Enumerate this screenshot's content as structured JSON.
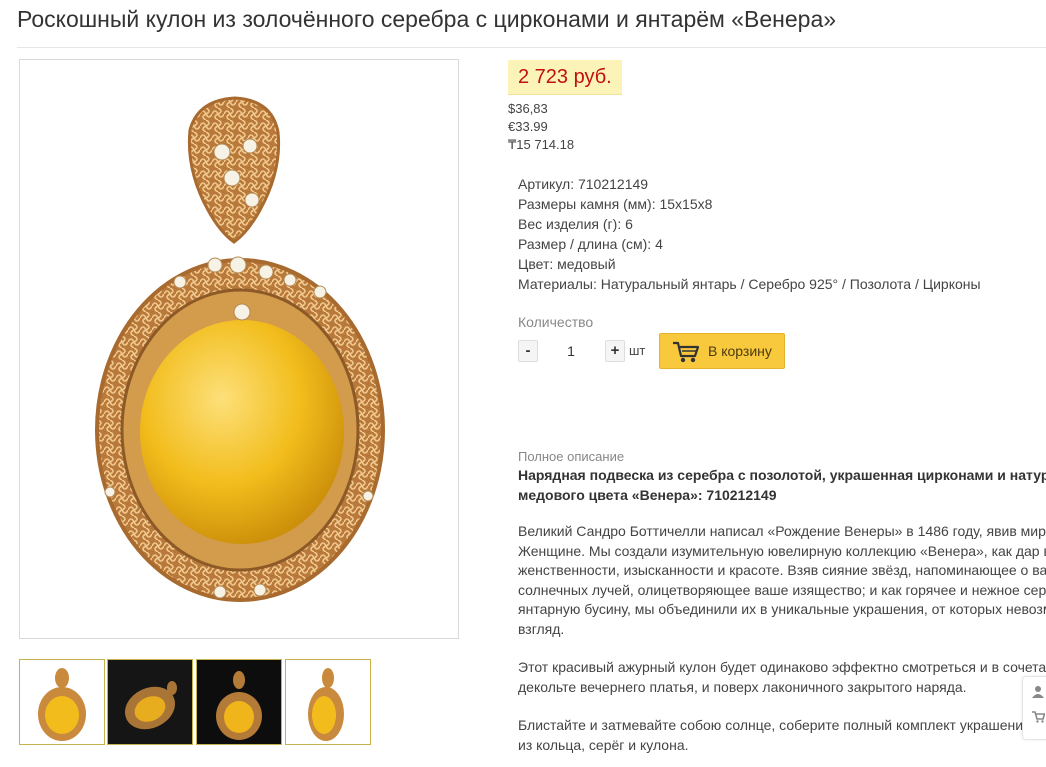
{
  "product": {
    "title": "Роскошный кулон из золочённого серебра с цирконами и янтарём «Венера»"
  },
  "price": {
    "main": "2 723 руб.",
    "usd": "$36,83",
    "eur": "€33.99",
    "kzt": "₸15 714.18"
  },
  "specs": [
    "Артикул: 710212149",
    "Размеры камня (мм): 15х15х8",
    "Вес изделия (г): 6",
    "Размер / длина (см): 4",
    "Цвет: медовый",
    "Материалы: Натуральный янтарь / Серебро 925° / Позолота / Цирконы"
  ],
  "quantity": {
    "label": "Количество",
    "minus": "-",
    "value": "1",
    "plus": "+",
    "unit": "шт"
  },
  "cart": {
    "label": "В корзину",
    "icon": "cart-icon"
  },
  "description": {
    "heading": "Полное описание",
    "title_line1": "Нарядная подвеска из серебра с позолотой, украшенная цирконами и натур",
    "title_line2": "медового цвета «Венера»: 710212149",
    "p1": [
      "Великий Сандро Боттичелли написал «Рождение Венеры» в 1486 году, явив мир",
      "Женщине. Мы создали изумительную ювелирную коллекцию «Венера», как дар в",
      "женственности, изысканности и красоте. Взяв сияние звёзд, напоминающее о ва",
      "солнечных лучей, олицетворяющее ваше изящество; и как горячее и нежное сер",
      "янтарную бусину, мы объединили их в уникальные украшения, от которых невозм",
      "взгляд."
    ],
    "p2": [
      "Этот красивый ажурный кулон будет одинаково эффектно смотреться и в сочета",
      "декольте вечернего платья, и поверх лаконичного закрытого наряда."
    ],
    "p3": [
      "Блистайте и затмевайте собою солнце, соберите полный комплект украшени",
      "из кольца, серёг и кулона."
    ]
  },
  "side_tools": {
    "user_icon": "user-icon",
    "cart_icon": "cart-icon"
  },
  "colors": {
    "price_text": "#c01010",
    "price_bg": "#fcf3b8",
    "cart_button": "#f8c93c",
    "amber": "#f2bd1c",
    "gold": "#c98a3e"
  }
}
